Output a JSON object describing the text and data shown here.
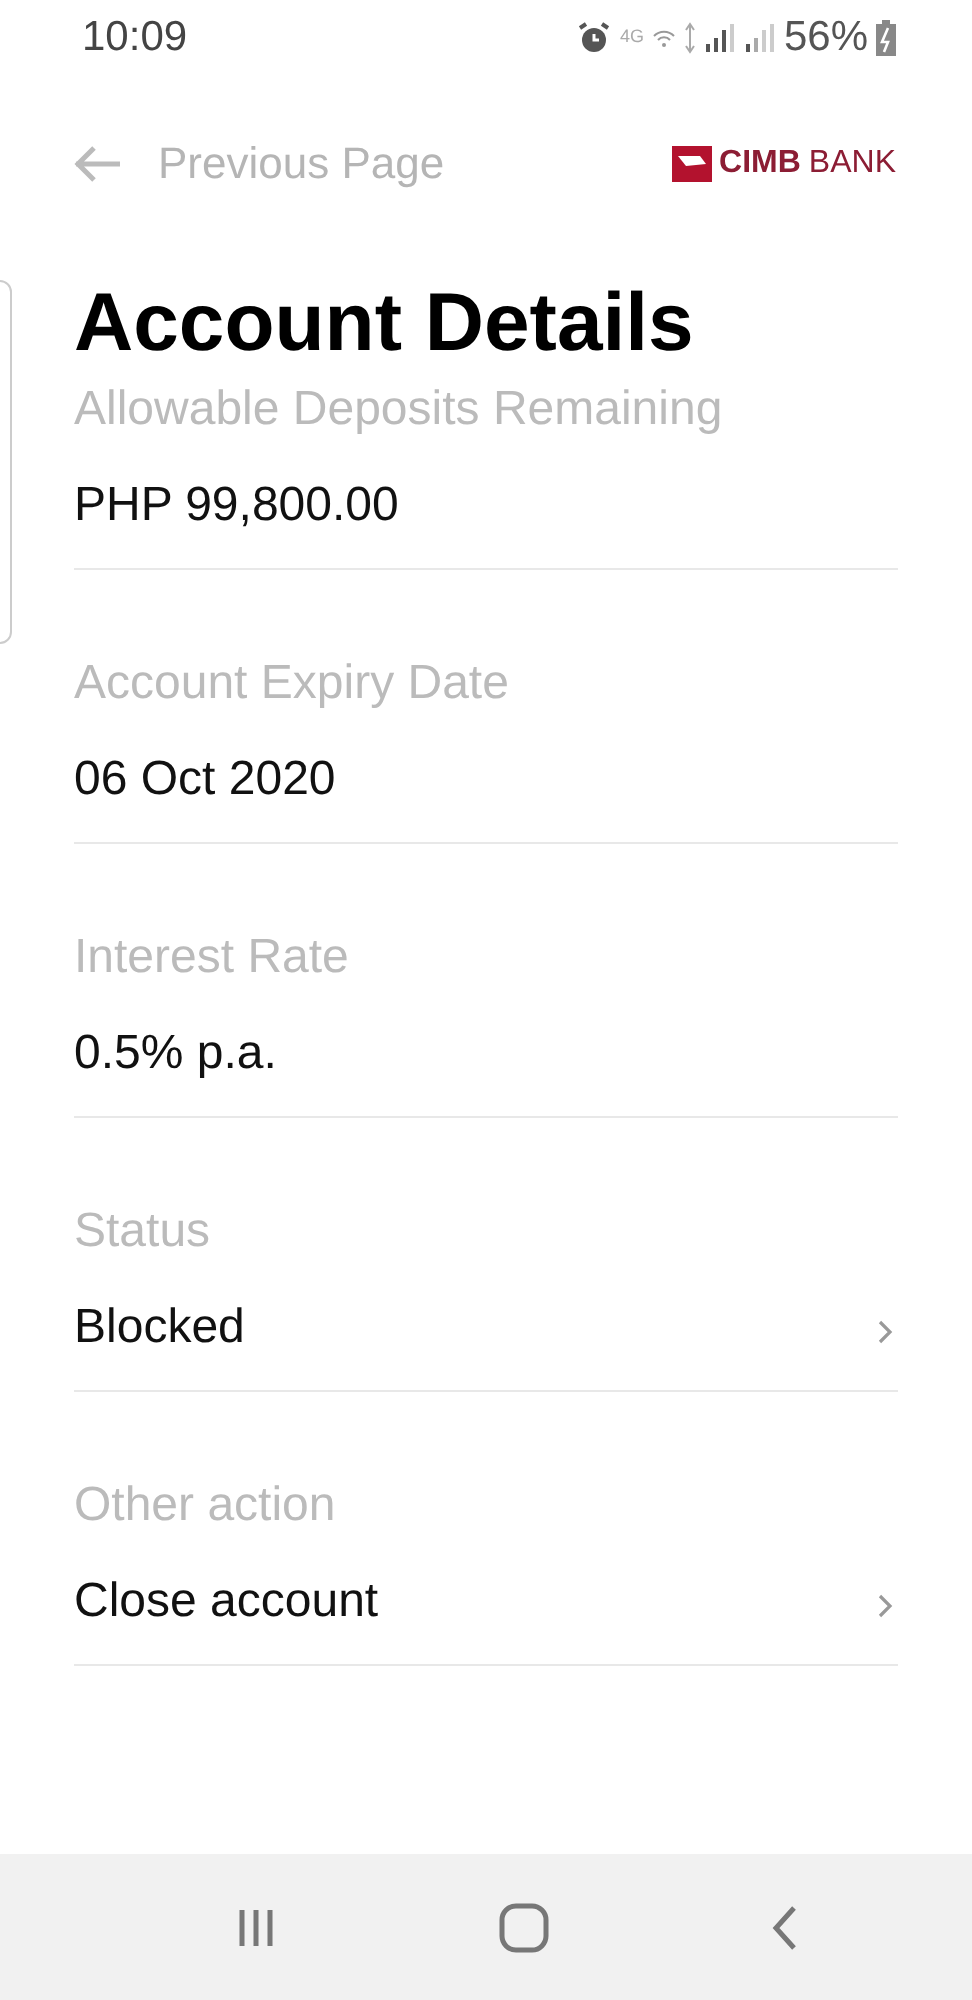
{
  "status_bar": {
    "time": "10:09",
    "network": "4G",
    "battery": "56%"
  },
  "header": {
    "back_label": "Previous Page",
    "brand": {
      "bold": "CIMB",
      "light": "BANK"
    }
  },
  "title": "Account Details",
  "fields": [
    {
      "kind": "info",
      "label": "Allowable Deposits Remaining",
      "value": "PHP 99,800.00"
    },
    {
      "kind": "info",
      "label": "Account Expiry Date",
      "value": "06 Oct 2020"
    },
    {
      "kind": "info",
      "label": "Interest Rate",
      "value": "0.5% p.a."
    },
    {
      "kind": "link",
      "label": "Status",
      "value": "Blocked"
    },
    {
      "kind": "link",
      "label": "Other action",
      "value": "Close account"
    }
  ]
}
